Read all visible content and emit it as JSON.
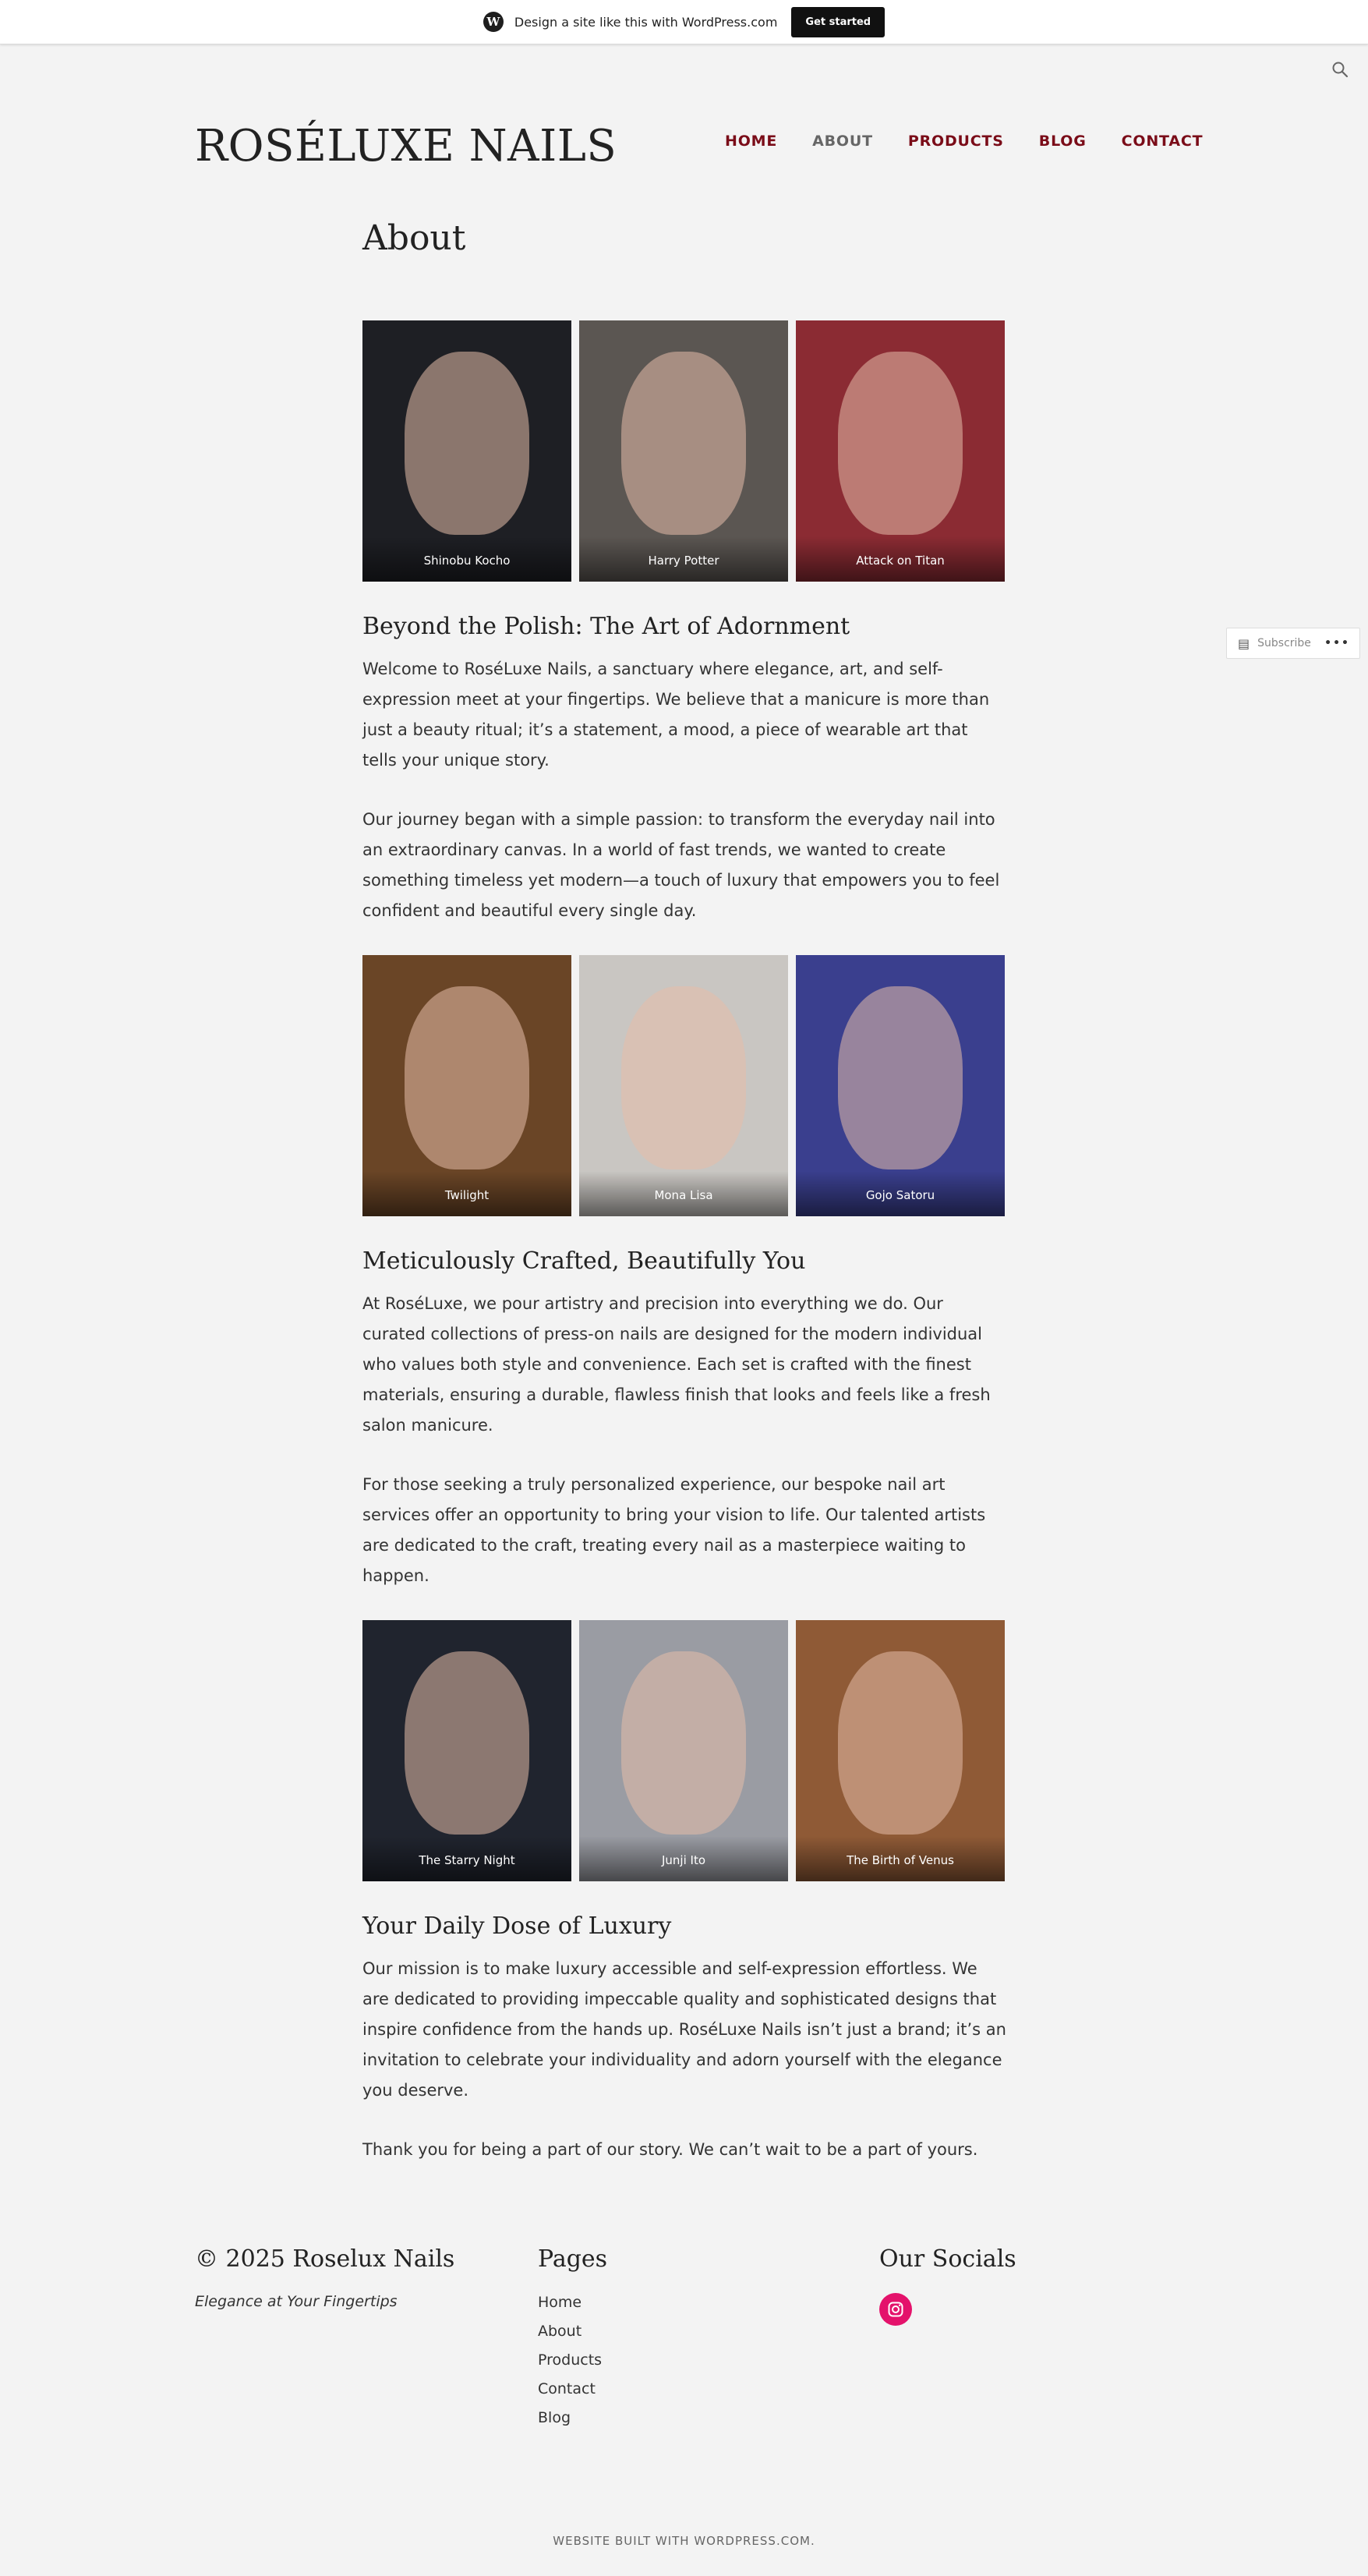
{
  "wpbar": {
    "text": "Design a site like this with WordPress.com",
    "button": "Get started",
    "logo": "W"
  },
  "site": {
    "title": "ROSÉLUXE NAILS"
  },
  "nav": [
    {
      "label": "HOME"
    },
    {
      "label": "ABOUT"
    },
    {
      "label": "PRODUCTS"
    },
    {
      "label": "BLOG"
    },
    {
      "label": "CONTACT"
    }
  ],
  "page": {
    "title": "About"
  },
  "gallery1": [
    {
      "caption": "Shinobu Kocho",
      "color": "#1e1f24"
    },
    {
      "caption": "Harry Potter",
      "color": "#5b5652"
    },
    {
      "caption": "Attack on Titan",
      "color": "#8b2b33"
    }
  ],
  "section1": {
    "heading": "Beyond the Polish: The Art of Adornment",
    "p1": "Welcome to RoséLuxe Nails, a sanctuary where elegance, art, and self-expression meet at your fingertips. We believe that a manicure is more than just a beauty ritual; it’s a statement, a mood, a piece of wearable art that tells your unique story.",
    "p2": "Our journey began with a simple passion: to transform the everyday nail into an extraordinary canvas. In a world of fast trends, we wanted to create something timeless yet modern—a touch of luxury that empowers you to feel confident and beautiful every single day."
  },
  "gallery2": [
    {
      "caption": "Twilight",
      "color": "#6a4526"
    },
    {
      "caption": "Mona Lisa",
      "color": "#c9c6c2"
    },
    {
      "caption": "Gojo Satoru",
      "color": "#3a3f8e"
    }
  ],
  "section2": {
    "heading": "Meticulously Crafted, Beautifully You",
    "p1": "At RoséLuxe, we pour artistry and precision into everything we do. Our curated collections of press-on nails are designed for the modern individual who values both style and convenience. Each set is crafted with the finest materials, ensuring a durable, flawless finish that looks and feels like a fresh salon manicure.",
    "p2": "For those seeking a truly personalized experience, our bespoke nail art services offer an opportunity to bring your vision to life. Our talented artists are dedicated to the craft, treating every nail as a masterpiece waiting to happen."
  },
  "gallery3": [
    {
      "caption": "The Starry Night",
      "color": "#20242e"
    },
    {
      "caption": "Junji Ito",
      "color": "#9a9ca3"
    },
    {
      "caption": "The Birth of Venus",
      "color": "#8f5a36"
    }
  ],
  "section3": {
    "heading": "Your Daily Dose of Luxury",
    "p1": "Our mission is to make luxury accessible and self-expression effortless. We are dedicated to providing impeccable quality and sophisticated designs that inspire confidence from the hands up. RoséLuxe Nails isn’t just a brand; it’s an invitation to celebrate your individuality and adorn yourself with the elegance you deserve.",
    "p2": "Thank you for being a part of our story. We can’t wait to be a part of yours."
  },
  "footer": {
    "copyright": "© 2025 Roselux Nails",
    "tagline": "Elegance at Your Fingertips",
    "pages_title": "Pages",
    "pages": [
      "Home",
      "About",
      "Products",
      "Contact",
      "Blog"
    ],
    "socials_title": "Our Socials",
    "instagram_color": "#e4126b",
    "credit": "WEBSITE BUILT WITH WORDPRESS.COM."
  },
  "subscribe": {
    "label": "Subscribe",
    "more": "•••"
  }
}
